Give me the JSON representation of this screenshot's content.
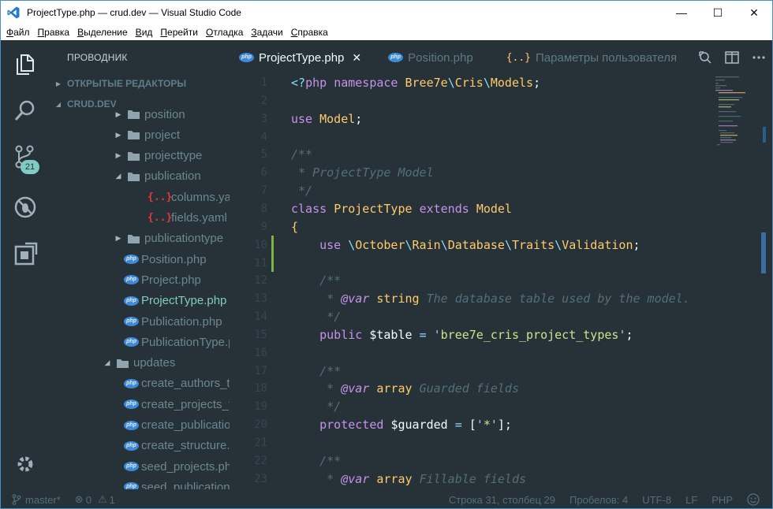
{
  "window": {
    "title": "ProjectType.php — crud.dev — Visual Studio Code",
    "controls": {
      "minimize": "—",
      "maximize": "☐",
      "close": "✕"
    }
  },
  "menu": [
    "Файл",
    "Правка",
    "Выделение",
    "Вид",
    "Перейти",
    "Отладка",
    "Задачи",
    "Справка"
  ],
  "activity": {
    "scm_badge": "21"
  },
  "sidebar": {
    "title": "ПРОВОДНИК",
    "open_editors": "ОТКРЫТЫЕ РЕДАКТОРЫ",
    "project": "CRUD.DEV",
    "tree": [
      {
        "label": "position",
        "kind": "folder",
        "state": "collapsed",
        "depth": 2
      },
      {
        "label": "project",
        "kind": "folder",
        "state": "collapsed",
        "depth": 2
      },
      {
        "label": "projecttype",
        "kind": "folder",
        "state": "collapsed",
        "depth": 2
      },
      {
        "label": "publication",
        "kind": "folder",
        "state": "expanded",
        "depth": 2
      },
      {
        "label": "columns.yaml",
        "kind": "yaml",
        "depth": 3
      },
      {
        "label": "fields.yaml",
        "kind": "yaml",
        "depth": 3
      },
      {
        "label": "publicationtype",
        "kind": "folder",
        "state": "collapsed",
        "depth": 2
      },
      {
        "label": "Position.php",
        "kind": "php",
        "depth": 2
      },
      {
        "label": "Project.php",
        "kind": "php",
        "depth": 2
      },
      {
        "label": "ProjectType.php",
        "kind": "php",
        "depth": 2,
        "active": true
      },
      {
        "label": "Publication.php",
        "kind": "php",
        "depth": 2
      },
      {
        "label": "PublicationType.php",
        "kind": "php",
        "depth": 2
      },
      {
        "label": "updates",
        "kind": "folder",
        "state": "expanded",
        "depth": 1
      },
      {
        "label": "create_authors_table.php",
        "kind": "php",
        "depth": 2
      },
      {
        "label": "create_projects_table.php",
        "kind": "php",
        "depth": 2
      },
      {
        "label": "create_publications_table.php",
        "kind": "php",
        "depth": 2
      },
      {
        "label": "create_structure.php",
        "kind": "php",
        "depth": 2
      },
      {
        "label": "seed_projects.php",
        "kind": "php",
        "depth": 2
      },
      {
        "label": "seed_publications.php",
        "kind": "php",
        "depth": 2
      }
    ]
  },
  "tabs": [
    {
      "label": "ProjectType.php",
      "icon": "php",
      "active": true,
      "close": "✕"
    },
    {
      "label": "Position.php",
      "icon": "php",
      "active": false
    },
    {
      "label": "Параметры пользователя",
      "icon": "settings-json",
      "active": false
    }
  ],
  "editor": {
    "line_numbers": [
      "1",
      "2",
      "3",
      "4",
      "5",
      "6",
      "7",
      "8",
      "9",
      "10",
      "11",
      "12",
      "13",
      "14",
      "15",
      "16",
      "17",
      "18",
      "19",
      "20",
      "21",
      "22",
      "23"
    ],
    "lines": [
      [
        [
          "op",
          "<?"
        ],
        [
          "kw",
          "php "
        ],
        [
          "kw",
          "namespace "
        ],
        [
          "tp",
          "Bree7e"
        ],
        [
          "op",
          "\\"
        ],
        [
          "tp",
          "Cris"
        ],
        [
          "op",
          "\\"
        ],
        [
          "tp",
          "Models"
        ],
        [
          "tx",
          ";"
        ]
      ],
      [],
      [
        [
          "kw",
          "use "
        ],
        [
          "tp",
          "Model"
        ],
        [
          "tx",
          ";"
        ]
      ],
      [],
      [
        [
          "cm",
          "/**"
        ]
      ],
      [
        [
          "cm",
          " * ProjectType Model"
        ]
      ],
      [
        [
          "cm",
          " */"
        ]
      ],
      [
        [
          "kw",
          "class "
        ],
        [
          "tp",
          "ProjectType "
        ],
        [
          "kw",
          "extends "
        ],
        [
          "tp",
          "Model"
        ]
      ],
      [
        [
          "tp",
          "{"
        ]
      ],
      [
        [
          "tx",
          "    "
        ],
        [
          "kw",
          "use "
        ],
        [
          "op",
          "\\"
        ],
        [
          "tp",
          "October"
        ],
        [
          "op",
          "\\"
        ],
        [
          "tp",
          "Rain"
        ],
        [
          "op",
          "\\"
        ],
        [
          "tp",
          "Database"
        ],
        [
          "op",
          "\\"
        ],
        [
          "tp",
          "Traits"
        ],
        [
          "op",
          "\\"
        ],
        [
          "tp",
          "Validation"
        ],
        [
          "tx",
          ";"
        ]
      ],
      [],
      [
        [
          "tx",
          "    "
        ],
        [
          "cm",
          "/**"
        ]
      ],
      [
        [
          "tx",
          "     "
        ],
        [
          "cm",
          "* "
        ],
        [
          "an",
          "@var "
        ],
        [
          "tp",
          "string "
        ],
        [
          "cm",
          "The database table used by the model."
        ]
      ],
      [
        [
          "tx",
          "     "
        ],
        [
          "cm",
          "*/"
        ]
      ],
      [
        [
          "tx",
          "    "
        ],
        [
          "kw",
          "public "
        ],
        [
          "tx",
          "$table "
        ],
        [
          "op",
          "= "
        ],
        [
          "op",
          "'"
        ],
        [
          "st",
          "bree7e_cris_project_types"
        ],
        [
          "op",
          "'"
        ],
        [
          "tx",
          ";"
        ]
      ],
      [],
      [
        [
          "tx",
          "    "
        ],
        [
          "cm",
          "/**"
        ]
      ],
      [
        [
          "tx",
          "     "
        ],
        [
          "cm",
          "* "
        ],
        [
          "an",
          "@var "
        ],
        [
          "tp",
          "array "
        ],
        [
          "cm",
          "Guarded fields"
        ]
      ],
      [
        [
          "tx",
          "     "
        ],
        [
          "cm",
          "*/"
        ]
      ],
      [
        [
          "tx",
          "    "
        ],
        [
          "kw",
          "protected "
        ],
        [
          "tx",
          "$guarded "
        ],
        [
          "op",
          "= "
        ],
        [
          "tx",
          "["
        ],
        [
          "op",
          "'"
        ],
        [
          "st",
          "*"
        ],
        [
          "op",
          "'"
        ],
        [
          "tx",
          "];"
        ]
      ],
      [],
      [
        [
          "tx",
          "    "
        ],
        [
          "cm",
          "/**"
        ]
      ],
      [
        [
          "tx",
          "     "
        ],
        [
          "cm",
          "* "
        ],
        [
          "an",
          "@var "
        ],
        [
          "tp",
          "array "
        ],
        [
          "cm",
          "Fillable fields"
        ]
      ]
    ]
  },
  "status": {
    "branch": "master*",
    "errors": "0",
    "warnings": "1",
    "position": "Строка 31, столбец 29",
    "indent": "Пробелов: 4",
    "encoding": "UTF-8",
    "eol": "LF",
    "language": "PHP"
  },
  "colors": {
    "background": "#263238",
    "accent": "#80cbc4",
    "keyword": "#c792ea",
    "type": "#ffcb6b",
    "string": "#c3e88d",
    "comment": "#546e7a",
    "operator": "#89ddff"
  }
}
